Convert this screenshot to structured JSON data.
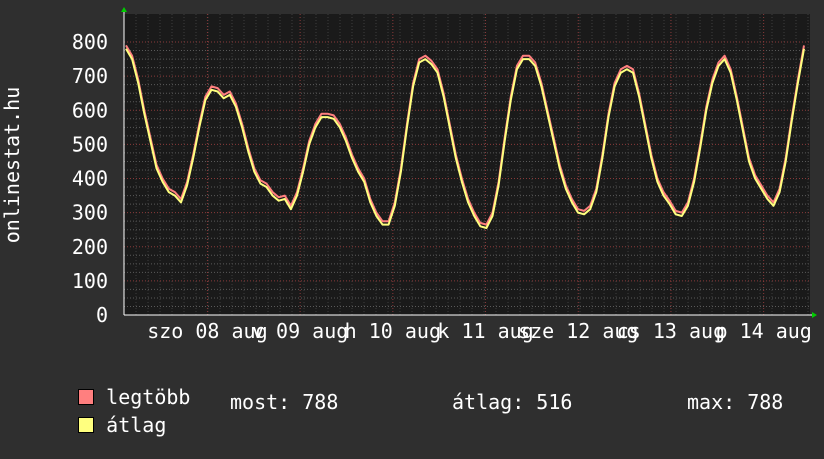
{
  "chart_data": {
    "type": "line",
    "ylabel": "onlinestat.hu",
    "ylim": [
      0,
      800
    ],
    "yticks": [
      0,
      100,
      200,
      300,
      400,
      500,
      600,
      700,
      800
    ],
    "xtick_labels": [
      "szo 08 aug",
      "v 09 aug",
      "h 10 aug",
      "k 11 aug",
      "sze 12 aug",
      "cs 13 aug",
      "p 14 aug"
    ],
    "series": [
      {
        "name": "legtöbb",
        "color": "#ff7f7f",
        "values": [
          790,
          760,
          690,
          600,
          520,
          440,
          400,
          370,
          360,
          340,
          390,
          470,
          560,
          640,
          670,
          665,
          645,
          655,
          620,
          560,
          490,
          430,
          395,
          385,
          360,
          345,
          350,
          320,
          360,
          430,
          510,
          560,
          590,
          590,
          585,
          560,
          520,
          470,
          430,
          400,
          340,
          300,
          275,
          275,
          330,
          430,
          560,
          680,
          750,
          760,
          745,
          720,
          650,
          560,
          470,
          400,
          340,
          300,
          270,
          265,
          300,
          390,
          520,
          640,
          730,
          760,
          760,
          740,
          680,
          600,
          520,
          440,
          380,
          340,
          310,
          305,
          320,
          370,
          470,
          590,
          680,
          720,
          730,
          720,
          650,
          560,
          470,
          400,
          360,
          335,
          305,
          300,
          330,
          400,
          500,
          610,
          690,
          740,
          760,
          720,
          640,
          550,
          460,
          410,
          380,
          350,
          330,
          370,
          460,
          580,
          690,
          790
        ]
      },
      {
        "name": "átlag",
        "color": "#ffff7f",
        "values": [
          780,
          750,
          680,
          590,
          510,
          430,
          390,
          360,
          350,
          330,
          380,
          460,
          550,
          630,
          660,
          655,
          635,
          645,
          610,
          550,
          480,
          420,
          385,
          375,
          350,
          335,
          340,
          310,
          350,
          420,
          500,
          550,
          580,
          580,
          575,
          550,
          510,
          460,
          420,
          390,
          330,
          290,
          265,
          265,
          320,
          420,
          550,
          670,
          740,
          750,
          735,
          710,
          640,
          550,
          460,
          390,
          330,
          290,
          260,
          255,
          290,
          380,
          510,
          630,
          720,
          750,
          750,
          730,
          670,
          590,
          510,
          430,
          370,
          330,
          300,
          295,
          310,
          360,
          460,
          580,
          670,
          710,
          720,
          710,
          640,
          550,
          460,
          390,
          350,
          325,
          295,
          290,
          320,
          390,
          490,
          600,
          680,
          730,
          750,
          710,
          630,
          540,
          450,
          400,
          370,
          340,
          320,
          360,
          450,
          570,
          680,
          780
        ]
      }
    ]
  },
  "legend": {
    "max_label": "legtöbb",
    "avg_label": "átlag"
  },
  "stats": {
    "now": "most: 788",
    "avg": "átlag: 516",
    "max": "max: 788"
  }
}
